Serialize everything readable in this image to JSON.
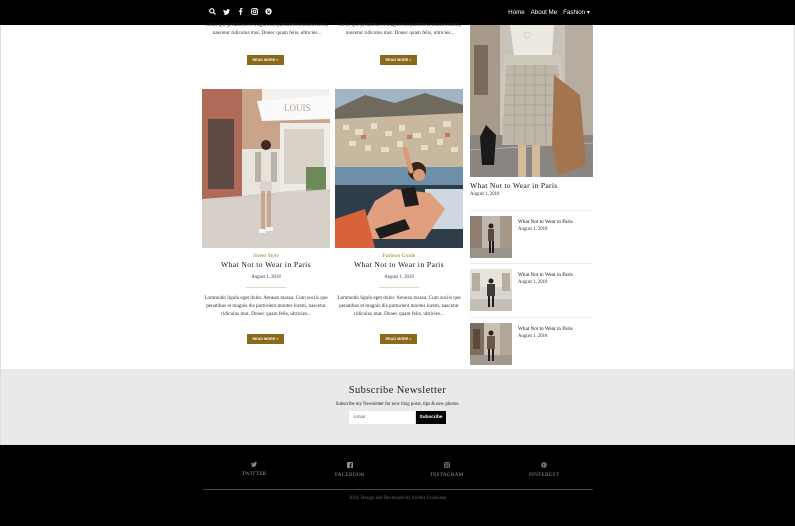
{
  "nav": {
    "icons": [
      "search-icon",
      "twitter-icon",
      "facebook-icon",
      "instagram-icon",
      "pinterest-icon"
    ],
    "menu": [
      "Home",
      "About Me",
      "Fashion ▾"
    ]
  },
  "posts_top": [
    {
      "excerpt": "sociis que penatibus et magnis dis parturient montes lorem, nascetur ridiculus mut. Donec quam felis, ultricies...",
      "read_more": "READ MORE »"
    },
    {
      "excerpt": "sociis que penatibus et magnis dis parturient montes lorem, nascetur ridiculus mut. Donec quam felis, ultricies...",
      "read_more": "READ MORE »"
    }
  ],
  "posts": [
    {
      "category": "Street Style",
      "title": "What Not to Wear in Paris",
      "date": "August 1, 2018",
      "excerpt": "Lommodo ligula eget dolor. Aenean massa. Cum sociis que penatibus et magnis dis parturient montes lorem, nascetur ridiculus mut. Donec quam felis, ultricies...",
      "read_more": "READ MORE »"
    },
    {
      "category": "Fashion Guide",
      "title": "What Not to Wear in Paris",
      "date": "August 1, 2018",
      "excerpt": "Lommodo ligula eget dolor. Aenean massa. Cum sociis que penatibus et magnis dis parturient montes lorem, nascetur ridiculus mut. Donec quam felis, ultricies...",
      "read_more": "READ MORE »"
    }
  ],
  "sidebar": {
    "featured": {
      "title": "What Not to Wear in Paris",
      "date": "August 1, 2018"
    },
    "recent": [
      {
        "title": "What Not to Wear in Paris",
        "date": "August 1, 2018"
      },
      {
        "title": "What Not to Wear in Paris",
        "date": "August 1, 2018"
      },
      {
        "title": "What Not to Wear in Paris",
        "date": "August 1, 2018"
      }
    ]
  },
  "newsletter": {
    "title": "Subscribe Newsletter",
    "subtitle": "Subscribe my Newsletter for new blog posts, tips & new photos.",
    "email_placeholder": "Email",
    "button": "Subscribe"
  },
  "footer": {
    "social": [
      {
        "icon": "twitter-icon",
        "label": "TWITTER"
      },
      {
        "icon": "facebook-icon",
        "label": "FACEBOOK"
      },
      {
        "icon": "instagram-icon",
        "label": "INSTAGRAM"
      },
      {
        "icon": "pinterest-icon",
        "label": "PINTEREST"
      }
    ],
    "copyright": "2018, Design and Developed by Andrea Unlawana"
  },
  "colors": {
    "accent": "#8a6a1a",
    "nav_bg": "#000000",
    "newsletter_bg": "#e9e9e9"
  }
}
